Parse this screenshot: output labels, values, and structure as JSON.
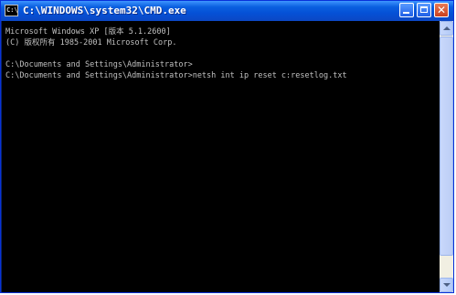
{
  "window": {
    "title": "C:\\WINDOWS\\system32\\CMD.exe",
    "icon_label": "C:\\"
  },
  "console": {
    "lines": [
      "Microsoft Windows XP [版本 5.1.2600]",
      "(C) 版权所有 1985-2001 Microsoft Corp.",
      "C:\\Documents and Settings\\Administrator>",
      "C:\\Documents and Settings\\Administrator>netsh int ip reset c:resetlog.txt"
    ]
  },
  "icons": {
    "app": "cmd-icon",
    "minimize": "minimize-icon",
    "maximize": "maximize-icon",
    "close": "close-icon",
    "scroll_up": "scroll-up-arrow-icon",
    "scroll_down": "scroll-down-arrow-icon"
  },
  "close_glyph": "✕",
  "colors": {
    "console_bg": "#000000",
    "console_text": "#c0c0c0",
    "titlebar": "#0551d6"
  }
}
